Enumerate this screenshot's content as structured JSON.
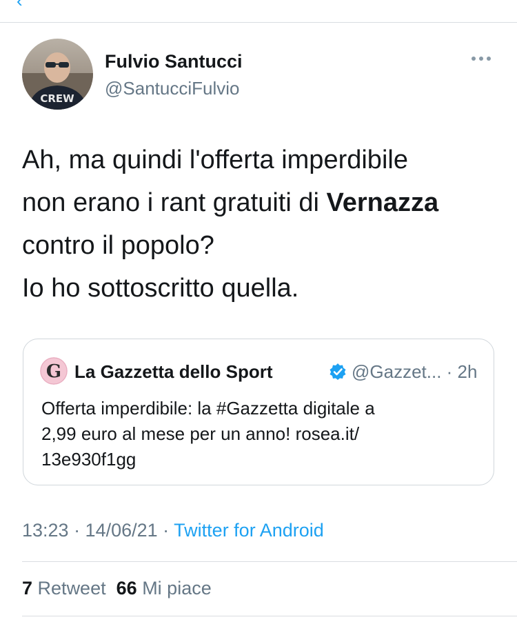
{
  "tweet": {
    "author": {
      "name": "Fulvio Santucci",
      "handle": "@SantucciFulvio",
      "avatar_shirt_text": "CREW"
    },
    "text_lines": [
      "Ah, ma quindi l'offerta imperdibile",
      "non erano i rant gratuiti di ",
      "Vernazza",
      "contro il popolo?",
      "Io ho sottoscritto quella."
    ],
    "quoted": {
      "avatar_letter": "G",
      "name": "La Gazzetta dello Sport",
      "handle_time": "@Gazzet... · 2h",
      "text_lines": [
        "Offerta imperdibile: la #Gazzetta digitale a",
        "2,99 euro al mese per un anno! rosea.it/",
        "13e930f1gg"
      ]
    },
    "meta": {
      "timestamp": "13:23 · 14/06/21 · ",
      "source": "Twitter for Android"
    },
    "stats": {
      "retweets": "7",
      "retweets_label": "Retweet",
      "likes": "66",
      "likes_label": "Mi piace"
    }
  },
  "colors": {
    "accent": "#1da1f2",
    "text": "#14171a",
    "secondary": "#657786",
    "border": "#d9dde1",
    "gazzetta_pink": "#f4c7d4"
  },
  "icons": {
    "back": "chevron-left-icon",
    "more": "more-horizontal-icon",
    "verified": "verified-badge-icon"
  }
}
